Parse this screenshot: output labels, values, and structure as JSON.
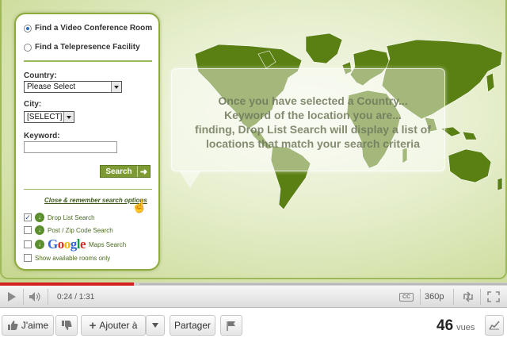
{
  "panel": {
    "radio_video": "Find a Video Conference Room",
    "radio_telepresence": "Find a Telepresence Facility",
    "country_label": "Country:",
    "country_value": "Please Select",
    "city_label": "City:",
    "city_value": "[SELECT]",
    "keyword_label": "Keyword:",
    "keyword_value": "",
    "search_label": "Search",
    "close_link": "Close & remember search options",
    "options": [
      {
        "label": "Drop List Search",
        "checked": true
      },
      {
        "label": "Post / Zip Code Search",
        "checked": false
      },
      {
        "label": "Maps Search",
        "checked": false
      },
      {
        "label": "Show available rooms only",
        "checked": false
      }
    ],
    "google_logo": "Google"
  },
  "callout": {
    "line1": "Once you have selected a Country...",
    "line2": "Keyword of the location you are...",
    "line3": "finding, Drop List Search will display a list of",
    "line4": "locations that match your search criteria"
  },
  "player": {
    "time": "0:24 / 1:31",
    "quality": "360p",
    "cc": "CC",
    "progress_fraction": 0.264
  },
  "actions": {
    "like": "J'aime",
    "add_to": "Ajouter à",
    "share": "Partager",
    "views_count": "46",
    "views_label": "vues"
  },
  "colors": {
    "accent": "#8dab3c",
    "map_green": "#5a7f12",
    "progress_red": "#d32121"
  }
}
